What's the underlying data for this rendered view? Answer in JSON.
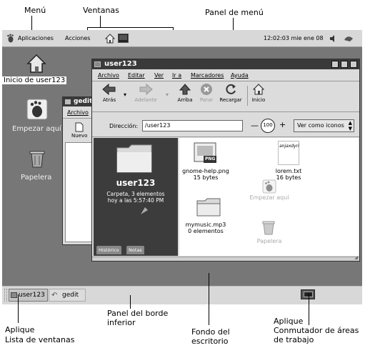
{
  "callouts": {
    "menu": "Menú",
    "windows": "Ventanas",
    "menu_panel": "Panel de menú",
    "bottom_panel_1": "Panel del borde",
    "bottom_panel_2": "inferior",
    "window_list_1": "Aplique",
    "window_list_2": "Lista de ventanas",
    "background_1": "Fondo del",
    "background_2": "escritorio",
    "workspace_1": "Aplique",
    "workspace_2": "Conmutador de áreas",
    "workspace_3": "de trabajo"
  },
  "top_panel": {
    "applications": "Aplicaciones",
    "actions": "Acciones",
    "clock": "12:02:03 mie ene 08"
  },
  "desktop": {
    "home_icon": "Inicio de user123",
    "start_icon": "Empezar aquí",
    "trash_icon": "Papelera"
  },
  "gedit_window": {
    "title": "gedit",
    "menu_file": "Archivo",
    "new_label": "Nuevo"
  },
  "nautilus": {
    "title": "user123",
    "menu": [
      "Archivo",
      "Editar",
      "Ver",
      "Ir a",
      "Marcadores",
      "Ayuda"
    ],
    "toolbar": {
      "back": "Atrás",
      "forward": "Adelante",
      "up": "Arriba",
      "stop": "Parar",
      "reload": "Recargar",
      "home": "Inicio"
    },
    "location_label": "Dirección:",
    "location_value": "/user123",
    "zoom": "100",
    "view_as": "Ver como iconos",
    "sidebar": {
      "folder_name": "user123",
      "info_line1": "Carpeta, 3 elementos",
      "info_line2": "hoy a las 5:57:40 PM",
      "tab_history": "Histórico",
      "tab_notes": "Notas"
    },
    "files": [
      {
        "name": "gnome-help.png",
        "size": "15 bytes",
        "badge": "PNG"
      },
      {
        "name": "lorem.txt",
        "size": "16 bytes",
        "preview": "anjaxdyri"
      },
      {
        "name": "mymusic.mp3",
        "size": "0 elementos"
      }
    ],
    "ghost_start": "Empezar aquí",
    "ghost_trash": "Papelera"
  },
  "bottom_panel": {
    "task_user": "user123",
    "task_gedit": "gedit"
  },
  "colors": {
    "desktop_bg": "#777777",
    "panel_bg": "#d8d8d8",
    "titlebar": "#3a3a3a",
    "sidebar_bg": "#3c3c3c"
  }
}
